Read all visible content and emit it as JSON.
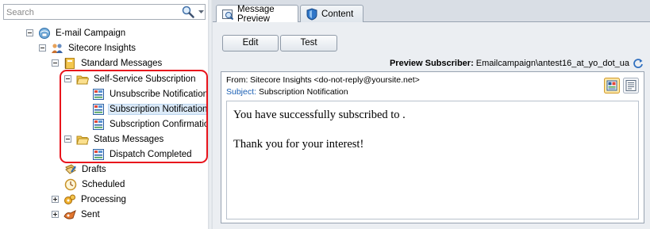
{
  "search": {
    "placeholder": "Search"
  },
  "tree": {
    "root": "E-mail Campaign",
    "manager": "Sitecore Insights",
    "standard_messages": "Standard Messages",
    "self_service": "Self-Service Subscription",
    "unsubscribe": "Unsubscribe Notification",
    "subscription_notification": "Subscription Notification",
    "subscription_confirmation": "Subscription Confirmation",
    "status_messages": "Status Messages",
    "dispatch_completed": "Dispatch Completed",
    "drafts": "Drafts",
    "scheduled": "Scheduled",
    "processing": "Processing",
    "sent": "Sent"
  },
  "tabs": {
    "preview": "Message Preview",
    "content": "Content"
  },
  "toolbar": {
    "edit": "Edit",
    "test": "Test",
    "subscriber_label": "Preview Subscriber:",
    "subscriber_value": "Emailcampaign\\antest16_at_yo_dot_ua"
  },
  "message": {
    "from_label": "From:",
    "from_value": "Sitecore Insights <do-not-reply@yoursite.net>",
    "subject_label": "Subject:",
    "subject_value": "Subscription Notification",
    "body_line1": "You have successfully subscribed to .",
    "body_line2": "Thank you for your interest!"
  },
  "colors": {
    "highlight": "#e8141c",
    "selection": "#dbeaf8",
    "subject_label": "#1a5fb4"
  }
}
